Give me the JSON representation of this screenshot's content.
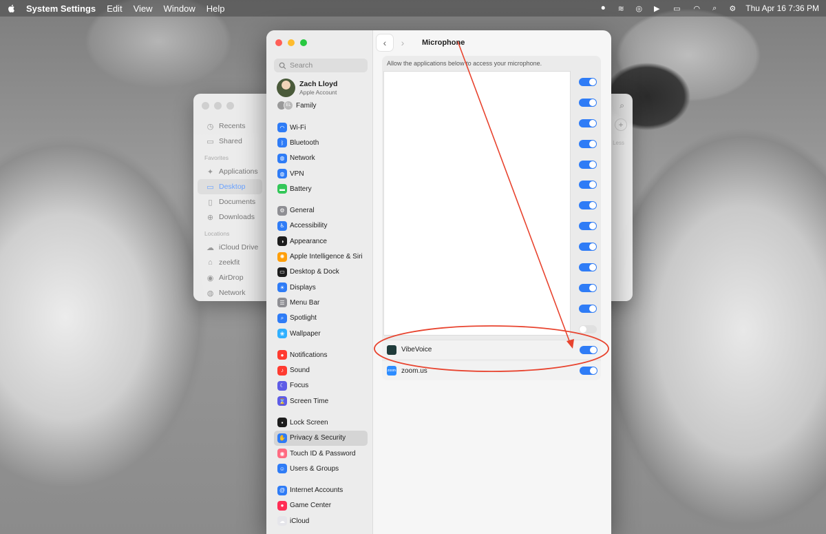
{
  "menubar": {
    "app": "System Settings",
    "menus": [
      "Edit",
      "View",
      "Window",
      "Help"
    ],
    "datetime": "Thu Apr 16  7:36 PM"
  },
  "finder": {
    "recents": "Recents",
    "shared": "Shared",
    "favorites_head": "Favorites",
    "applications": "Applications",
    "desktop": "Desktop",
    "documents": "Documents",
    "downloads": "Downloads",
    "locations_head": "Locations",
    "icloud_drive": "iCloud Drive",
    "home": "zeekfit",
    "airdrop": "AirDrop",
    "network": "Network",
    "less": "Less"
  },
  "settings": {
    "search_placeholder": "Search",
    "account": {
      "name": "Zach Lloyd",
      "subtitle": "Apple Account"
    },
    "family": "Family",
    "family_initials": "EL",
    "sidebar": [
      {
        "label": "Wi-Fi",
        "icon": "wifi-icon",
        "color": "#2f7cf6"
      },
      {
        "label": "Bluetooth",
        "icon": "bluetooth-icon",
        "color": "#2f7cf6"
      },
      {
        "label": "Network",
        "icon": "globe-icon",
        "color": "#2f7cf6"
      },
      {
        "label": "VPN",
        "icon": "globe-icon",
        "color": "#2f7cf6"
      },
      {
        "label": "Battery",
        "icon": "battery-icon",
        "color": "#34c759"
      },
      {
        "label": "General",
        "icon": "gear-icon",
        "color": "#8e8e93"
      },
      {
        "label": "Accessibility",
        "icon": "accessibility-icon",
        "color": "#2f7cf6"
      },
      {
        "label": "Appearance",
        "icon": "appearance-icon",
        "color": "#1d1d1d"
      },
      {
        "label": "Apple Intelligence & Siri",
        "icon": "siri-icon",
        "color": "#ff9f0a"
      },
      {
        "label": "Desktop & Dock",
        "icon": "dock-icon",
        "color": "#1d1d1d"
      },
      {
        "label": "Displays",
        "icon": "sun-icon",
        "color": "#2f7cf6"
      },
      {
        "label": "Menu Bar",
        "icon": "menubar-icon",
        "color": "#8e8e93"
      },
      {
        "label": "Spotlight",
        "icon": "search-icon",
        "color": "#2f7cf6"
      },
      {
        "label": "Wallpaper",
        "icon": "flower-icon",
        "color": "#30b0ff"
      },
      {
        "label": "Notifications",
        "icon": "bell-icon",
        "color": "#ff3b30"
      },
      {
        "label": "Sound",
        "icon": "speaker-icon",
        "color": "#ff3b30"
      },
      {
        "label": "Focus",
        "icon": "moon-icon",
        "color": "#5e5ce6"
      },
      {
        "label": "Screen Time",
        "icon": "hourglass-icon",
        "color": "#5e5ce6"
      },
      {
        "label": "Lock Screen",
        "icon": "lock-icon",
        "color": "#1d1d1d"
      },
      {
        "label": "Privacy & Security",
        "icon": "hand-icon",
        "color": "#2f7cf6"
      },
      {
        "label": "Touch ID & Password",
        "icon": "fingerprint-icon",
        "color": "#ff6b81"
      },
      {
        "label": "Users & Groups",
        "icon": "users-icon",
        "color": "#2f7cf6"
      },
      {
        "label": "Internet Accounts",
        "icon": "at-icon",
        "color": "#2f7cf6"
      },
      {
        "label": "Game Center",
        "icon": "gamecenter-icon",
        "color": "#ff2d55"
      },
      {
        "label": "iCloud",
        "icon": "cloud-icon",
        "color": "#e5e5ea"
      }
    ],
    "active_item": "Privacy & Security",
    "page_title": "Microphone",
    "hint": "Allow the applications below to access your microphone.",
    "apps": [
      {
        "name": "VibeVoice",
        "enabled": true,
        "icon_color": "#1f3b3a"
      },
      {
        "name": "zoom.us",
        "enabled": true,
        "icon_color": "#2d8cff",
        "icon_text": "zoom"
      }
    ],
    "list_toggles": [
      true,
      true,
      true,
      true,
      true,
      true,
      true,
      true,
      true,
      true,
      true,
      true,
      false
    ],
    "accent": "#2f7cf6",
    "annotation_color": "#e8432e"
  }
}
